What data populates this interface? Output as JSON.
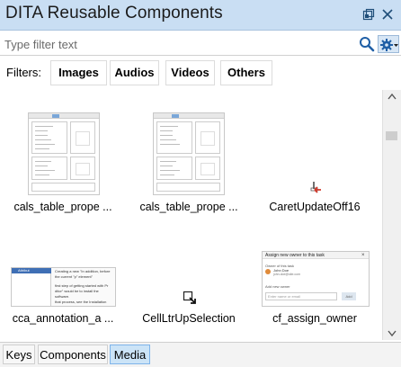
{
  "window": {
    "title": "DITA Reusable Components",
    "restore_icon": "restore-icon",
    "close_icon": "close-icon"
  },
  "filter": {
    "placeholder": "Type filter text",
    "value": ""
  },
  "filters": {
    "label": "Filters:",
    "buttons": [
      "Images",
      "Audios",
      "Videos",
      "Others"
    ]
  },
  "items": [
    {
      "label": "cals_table_prope ...",
      "kind": "table-screenshot"
    },
    {
      "label": "cals_table_prope ...",
      "kind": "table-screenshot"
    },
    {
      "label": "CaretUpdateOff16",
      "kind": "small-icon"
    },
    {
      "label": "cca_annotation_a ...",
      "kind": "annotation-screenshot"
    },
    {
      "label": "CellLtrUpSelection",
      "kind": "small-icon"
    },
    {
      "label": "cf_assign_owner",
      "kind": "dialog-screenshot"
    }
  ],
  "assign_dialog": {
    "title": "Assign new owner to this task",
    "section": "Owner of this task",
    "owner_name": "John Doe",
    "owner_email": "john.doe@site.com",
    "add_label": "Add new owner",
    "name_placeholder": "Enter name or email",
    "button": "Add"
  },
  "annotation_snippet": {
    "header": "Attribut",
    "line1": "Creating a new \"In addition, before the current \"p\" element\"",
    "line2": "first step of getting started with Pr",
    "line3": "ditor\" would be to install the software.",
    "line4": "that process, see the Installation"
  },
  "tabs": [
    {
      "label": "Keys",
      "active": false
    },
    {
      "label": "Components",
      "active": false
    },
    {
      "label": "Media",
      "active": true
    }
  ],
  "colors": {
    "titlebar": "#c9def3",
    "active_tab": "#cce4f7",
    "accent": "#1f5fa6"
  }
}
